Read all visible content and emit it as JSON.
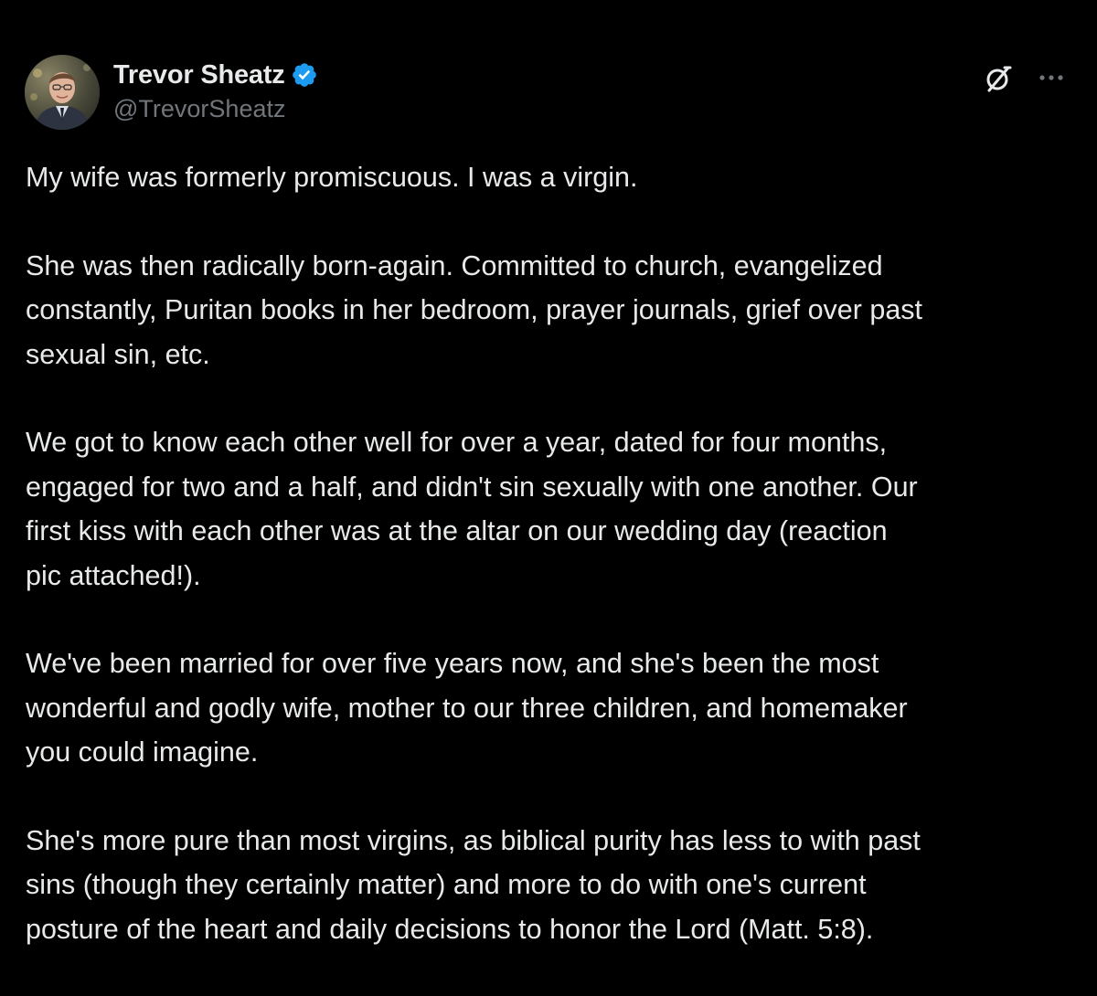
{
  "author": {
    "display_name": "Trevor Sheatz",
    "handle": "@TrevorSheatz",
    "verified": true,
    "avatar_icon": "profile-photo"
  },
  "header_actions": {
    "grok_icon": "grok-icon",
    "more_icon": "more-options-icon"
  },
  "colors": {
    "background": "#000000",
    "text": "#e7e9ea",
    "secondary_text": "#71767b",
    "verified_badge": "#1d9bf0"
  },
  "post": {
    "paragraphs": [
      {
        "lines": [
          "My wife was formerly promiscuous. I was a virgin."
        ]
      },
      {
        "lines": [
          "She was then radically born-again. Committed to church, evangelized",
          "constantly, Puritan books in her bedroom, prayer journals, grief over past",
          "sexual sin, etc."
        ]
      },
      {
        "lines": [
          "We got to know each other well for over a year, dated for four months,",
          "engaged for two and a half, and didn't sin sexually with one another. Our",
          "first kiss with each other was at the altar on our wedding day (reaction",
          "pic attached!)."
        ]
      },
      {
        "lines": [
          "We've been married for over five years now, and she's been the most",
          "wonderful and godly wife, mother to our three children, and homemaker",
          "you could imagine."
        ]
      },
      {
        "lines": [
          "She's more pure than most virgins, as biblical purity has less to with past",
          "sins (though they certainly matter) and more to do with one's current",
          "posture of the heart and daily decisions to honor the Lord (Matt. 5:8)."
        ]
      }
    ]
  }
}
